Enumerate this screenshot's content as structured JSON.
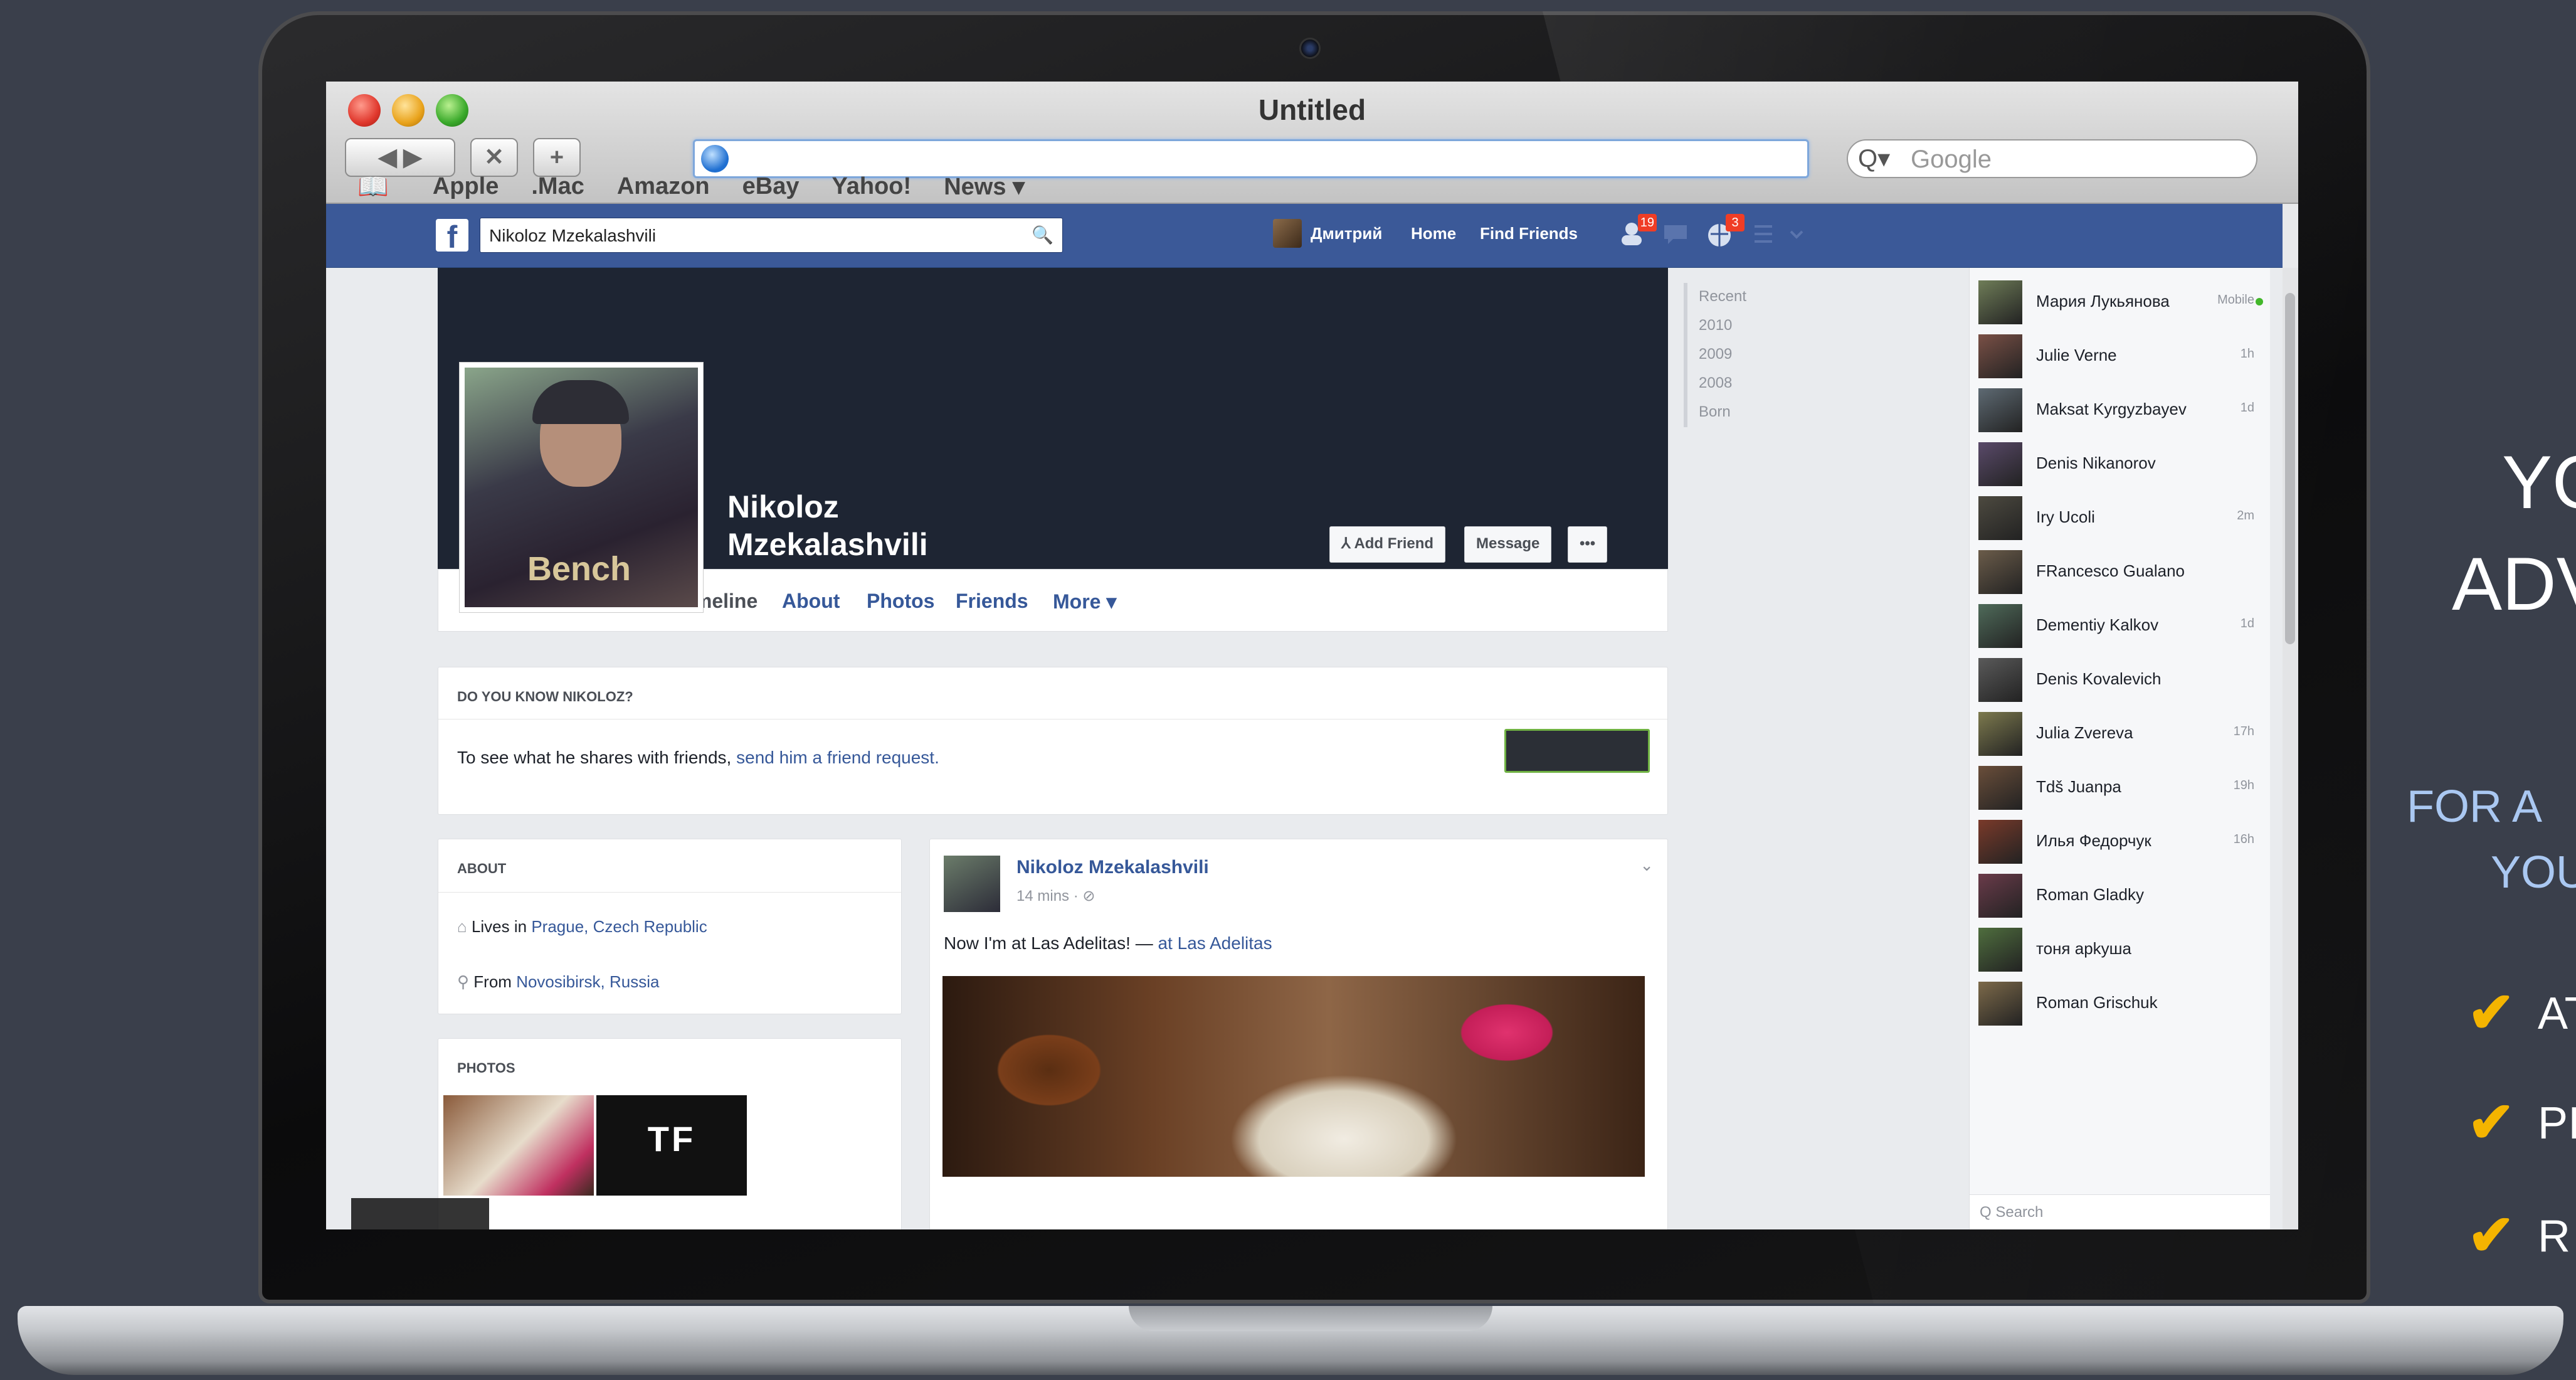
{
  "browser": {
    "window_title": "Untitled",
    "back_forward": "◀ ▶",
    "stop": "✕",
    "add": "+",
    "search_placeholder": "Google",
    "search_icon_glyph": "Q▾",
    "bookmark_icon_glyph": "📖",
    "bookmarks": [
      "Apple",
      ".Mac",
      "Amazon",
      "eBay",
      "Yahoo!",
      "News ▾"
    ]
  },
  "facebook": {
    "logo": "f",
    "search_value": "Nikoloz Mzekalashvili",
    "search_icon_glyph": "🔍",
    "nav_user": "Дмитрий",
    "nav_home": "Home",
    "nav_find_friends": "Find Friends",
    "friend_requests_count": "19",
    "notifications_count": "3",
    "profile": {
      "pic_text": "Bench",
      "first_name": "Nikoloz",
      "last_name": "Mzekalashvili",
      "add_friend": "⅄ Add Friend",
      "message": "Message",
      "more_dots": "•••"
    },
    "tabs": [
      "Timeline",
      "About",
      "Photos",
      "Friends",
      "More ▾"
    ],
    "know_card": {
      "heading": "DO YOU KNOW NIKOLOZ?",
      "text": "To see what he shares with friends,",
      "link": "send him a friend request."
    },
    "about_card": {
      "heading": "ABOUT",
      "lives_prefix": "Lives in",
      "lives": "Prague, Czech Republic",
      "from_prefix": "From",
      "from": "Novosibirsk, Russia"
    },
    "photos_card": {
      "heading": "PHOTOS",
      "thumb2_text": "TF"
    },
    "post": {
      "author": "Nikoloz Mzekalashvili",
      "time": "14 mins · ⊘",
      "text_prefix": "Now I'm at Las Adelitas! —",
      "text_at": "at",
      "place": "Las Adelitas"
    },
    "timeline_years": [
      "Recent",
      "2010",
      "2009",
      "2008",
      "Born"
    ],
    "chat": {
      "contacts": [
        {
          "name": "Мария Лукьянова",
          "meta": "Mobile"
        },
        {
          "name": "Julie Verne",
          "meta": "1h"
        },
        {
          "name": "Maksat Kyrgyzbayev",
          "meta": "1d"
        },
        {
          "name": "Denis Nikanorov",
          "meta": ""
        },
        {
          "name": "Iry Ucoli",
          "meta": "2m"
        },
        {
          "name": "FRancesco Gualano",
          "meta": ""
        },
        {
          "name": "Dementiy Kalkov",
          "meta": "1d"
        },
        {
          "name": "Denis Kovalevich",
          "meta": ""
        },
        {
          "name": "Julia Zvereva",
          "meta": "17h"
        },
        {
          "name": "Tdš Juanpa",
          "meta": "19h"
        },
        {
          "name": "Илья Федорчук",
          "meta": "16h"
        },
        {
          "name": "Roman Gladky",
          "meta": ""
        },
        {
          "name": "тоня арkуша",
          "meta": ""
        },
        {
          "name": "Roman Grischuk",
          "meta": ""
        }
      ],
      "search": "Q Search"
    }
  },
  "promo": {
    "line1": "YO",
    "line2": "ADV",
    "line3": "FOR A",
    "line4": "YOU",
    "checks": [
      "AT",
      "PI",
      "R"
    ],
    "check_glyph": "✔"
  },
  "colors": {
    "background": "#3a3f4b",
    "facebook_blue": "#3b5998",
    "check": "#f4b400",
    "promo_subtext": "#aac8f2"
  }
}
